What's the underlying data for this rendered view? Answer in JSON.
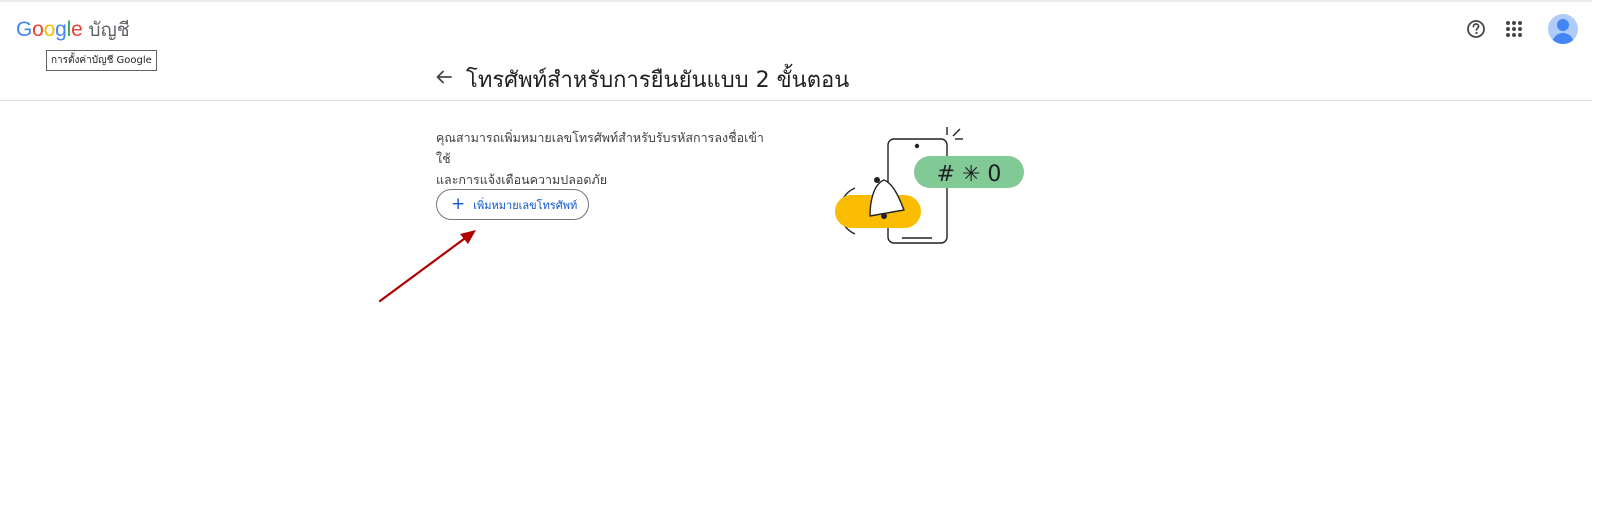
{
  "header": {
    "logo_letters": [
      "G",
      "o",
      "o",
      "g",
      "l",
      "e"
    ],
    "product_name": "บัญชี",
    "tooltip": "การตั้งค่าบัญชี Google",
    "icons": [
      "help-icon",
      "apps-grid-icon",
      "account-avatar-icon"
    ]
  },
  "main": {
    "title": "โทรศัพท์สำหรับการยืนยันแบบ 2 ขั้นตอน",
    "description_line1": "คุณสามารถเพิ่มหมายเลขโทรศัพท์สำหรับรับรหัสการลงชื่อเข้าใช้",
    "description_line2": "และการแจ้งเตือนความปลอดภัย",
    "add_button_label": "เพิ่มหมายเลขโทรศัพท์",
    "add_button_icon": "plus-icon"
  },
  "illustration": {
    "code_bubble_text": "# ✳ 0",
    "colors": {
      "green": "#81c995",
      "yellow": "#fbbc04",
      "outline": "#202124"
    }
  },
  "annotation": {
    "arrow_color": "#c00000"
  }
}
